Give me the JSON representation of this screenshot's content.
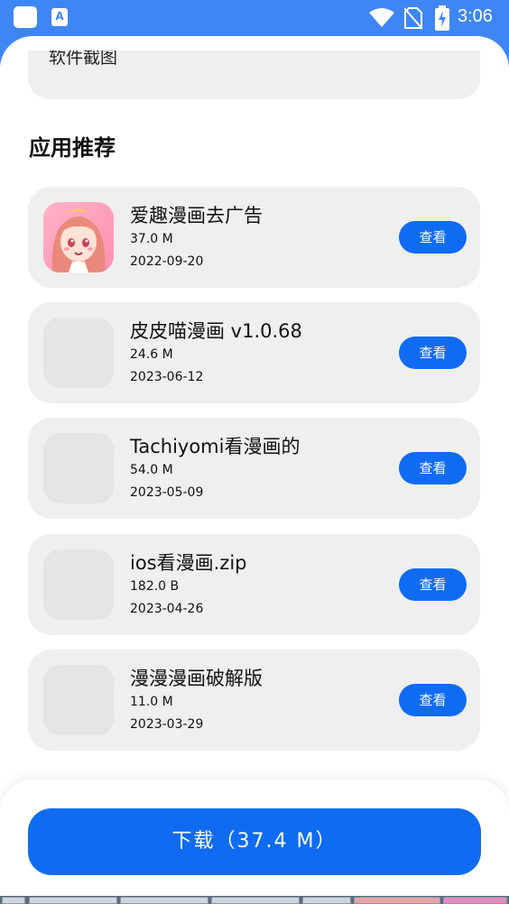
{
  "status_bar": {
    "time": "3:06",
    "a_icon_letter": "A",
    "icons": [
      "app-square-icon",
      "a-notification-icon",
      "wifi-icon",
      "no-sim-icon",
      "battery-charging-icon"
    ]
  },
  "screenshot_section": {
    "label": "软件截图"
  },
  "recommend": {
    "title": "应用推荐",
    "items": [
      {
        "name": "爱趣漫画去广告",
        "size": "37.0 M",
        "date": "2022-09-20",
        "button": "查看",
        "icon": "anime-girl-app-icon"
      },
      {
        "name": "皮皮喵漫画 v1.0.68",
        "size": "24.6 M",
        "date": "2023-06-12",
        "button": "查看",
        "icon": "placeholder-icon"
      },
      {
        "name": "Tachiyomi看漫画的",
        "size": "54.0 M",
        "date": "2023-05-09",
        "button": "查看",
        "icon": "placeholder-icon"
      },
      {
        "name": "ios看漫画.zip",
        "size": "182.0 B",
        "date": "2023-04-26",
        "button": "查看",
        "icon": "placeholder-icon"
      },
      {
        "name": "漫漫漫画破解版",
        "size": "11.0 M",
        "date": "2023-03-29",
        "button": "查看",
        "icon": "placeholder-icon"
      }
    ]
  },
  "download": {
    "label": "下载（37.4 M）"
  },
  "colors": {
    "primary": "#0f6cf2",
    "header_blue": "#3f86f5",
    "card_gray": "#efefef"
  }
}
